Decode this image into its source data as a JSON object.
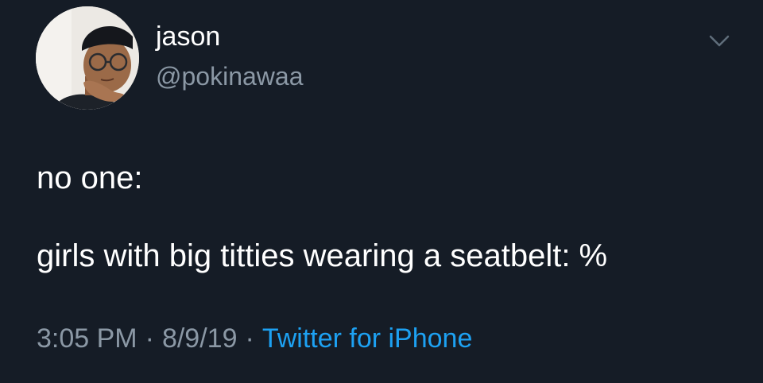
{
  "tweet": {
    "display_name": "jason",
    "handle": "@pokinawaa",
    "lines": [
      "no one:",
      "girls with big titties wearing a seatbelt: %"
    ],
    "time": "3:05 PM",
    "date": "8/9/19",
    "separator": "·",
    "source": "Twitter for iPhone",
    "more_icon": "chevron-down-icon",
    "avatar_icon": "user-avatar"
  },
  "colors": {
    "background": "#151c26",
    "text_primary": "#ffffff",
    "text_secondary": "#8b98a5",
    "link": "#1da1f2"
  }
}
